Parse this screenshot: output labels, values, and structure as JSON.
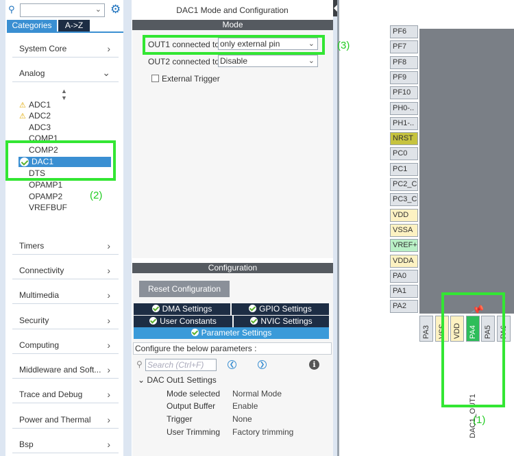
{
  "left": {
    "tabs": {
      "categories": "Categories",
      "az": "A->Z"
    },
    "categories_top": [
      {
        "label": "System Core",
        "state": "collapsed"
      },
      {
        "label": "Analog",
        "state": "expanded"
      }
    ],
    "analog_items": [
      {
        "label": "ADC1",
        "status": "warning"
      },
      {
        "label": "ADC2",
        "status": "warning"
      },
      {
        "label": "ADC3",
        "status": "none"
      },
      {
        "label": "COMP1",
        "status": "none"
      },
      {
        "label": "COMP2",
        "status": "none"
      },
      {
        "label": "DAC1",
        "status": "ok",
        "selected": true
      },
      {
        "label": "DTS",
        "status": "none"
      },
      {
        "label": "OPAMP1",
        "status": "none"
      },
      {
        "label": "OPAMP2",
        "status": "none"
      },
      {
        "label": "VREFBUF",
        "status": "none"
      }
    ],
    "categories_bottom": [
      {
        "label": "Timers"
      },
      {
        "label": "Connectivity"
      },
      {
        "label": "Multimedia"
      },
      {
        "label": "Security"
      },
      {
        "label": "Computing"
      },
      {
        "label": "Middleware and Soft..."
      },
      {
        "label": "Trace and Debug"
      },
      {
        "label": "Power and Thermal"
      },
      {
        "label": "Bsp"
      }
    ]
  },
  "mid": {
    "title": "DAC1 Mode and Configuration",
    "mode_header": "Mode",
    "out1_label": "OUT1 connected to",
    "out1_value": "only external pin",
    "out2_label": "OUT2 connected to",
    "out2_value": "Disable",
    "external_trigger": "External Trigger",
    "config_header": "Configuration",
    "reset_button": "Reset Configuration",
    "settings_tabs": {
      "dma": "DMA Settings",
      "gpio": "GPIO Settings",
      "user_constants": "User Constants",
      "nvic": "NVIC Settings",
      "parameter": "Parameter Settings"
    },
    "configure_text": "Configure the below parameters :",
    "search_placeholder": "Search (Ctrl+F)",
    "tree_header": "DAC Out1 Settings",
    "params": [
      {
        "name": "Mode selected",
        "value": "Normal Mode"
      },
      {
        "name": "Output Buffer",
        "value": "Enable"
      },
      {
        "name": "Trigger",
        "value": "None"
      },
      {
        "name": "User Trimming",
        "value": "Factory trimming"
      }
    ]
  },
  "right": {
    "left_pins": [
      {
        "label": "PF6",
        "kind": "io"
      },
      {
        "label": "PF7",
        "kind": "io"
      },
      {
        "label": "PF8",
        "kind": "io"
      },
      {
        "label": "PF9",
        "kind": "io"
      },
      {
        "label": "PF10",
        "kind": "io"
      },
      {
        "label": "PH0-..",
        "kind": "io"
      },
      {
        "label": "PH1-..",
        "kind": "io"
      },
      {
        "label": "NRST",
        "kind": "reset"
      },
      {
        "label": "PC0",
        "kind": "io"
      },
      {
        "label": "PC1",
        "kind": "io"
      },
      {
        "label": "PC2_C",
        "kind": "io"
      },
      {
        "label": "PC3_C",
        "kind": "io"
      },
      {
        "label": "VDD",
        "kind": "power"
      },
      {
        "label": "VSSA",
        "kind": "power"
      },
      {
        "label": "VREF+",
        "kind": "vref"
      },
      {
        "label": "VDDA",
        "kind": "power"
      },
      {
        "label": "PA0",
        "kind": "io"
      },
      {
        "label": "PA1",
        "kind": "io"
      },
      {
        "label": "PA2",
        "kind": "io"
      }
    ],
    "bottom_pins": [
      {
        "label": "PA3",
        "kind": "io"
      },
      {
        "label": "VSS",
        "kind": "power"
      },
      {
        "label": "VDD",
        "kind": "power"
      },
      {
        "label": "PA4",
        "kind": "active"
      },
      {
        "label": "PA5",
        "kind": "io"
      },
      {
        "label": "PA6",
        "kind": "io"
      }
    ],
    "signal_label": "DAC1_OUT1"
  },
  "annotations": {
    "a1": "(1)",
    "a2": "(2)",
    "a3": "(3)"
  },
  "colors": {
    "accent": "#3a8fd2",
    "highlight_green": "#33e633",
    "active_pin": "#2ebd5a",
    "header_dark": "#1d2d44"
  }
}
